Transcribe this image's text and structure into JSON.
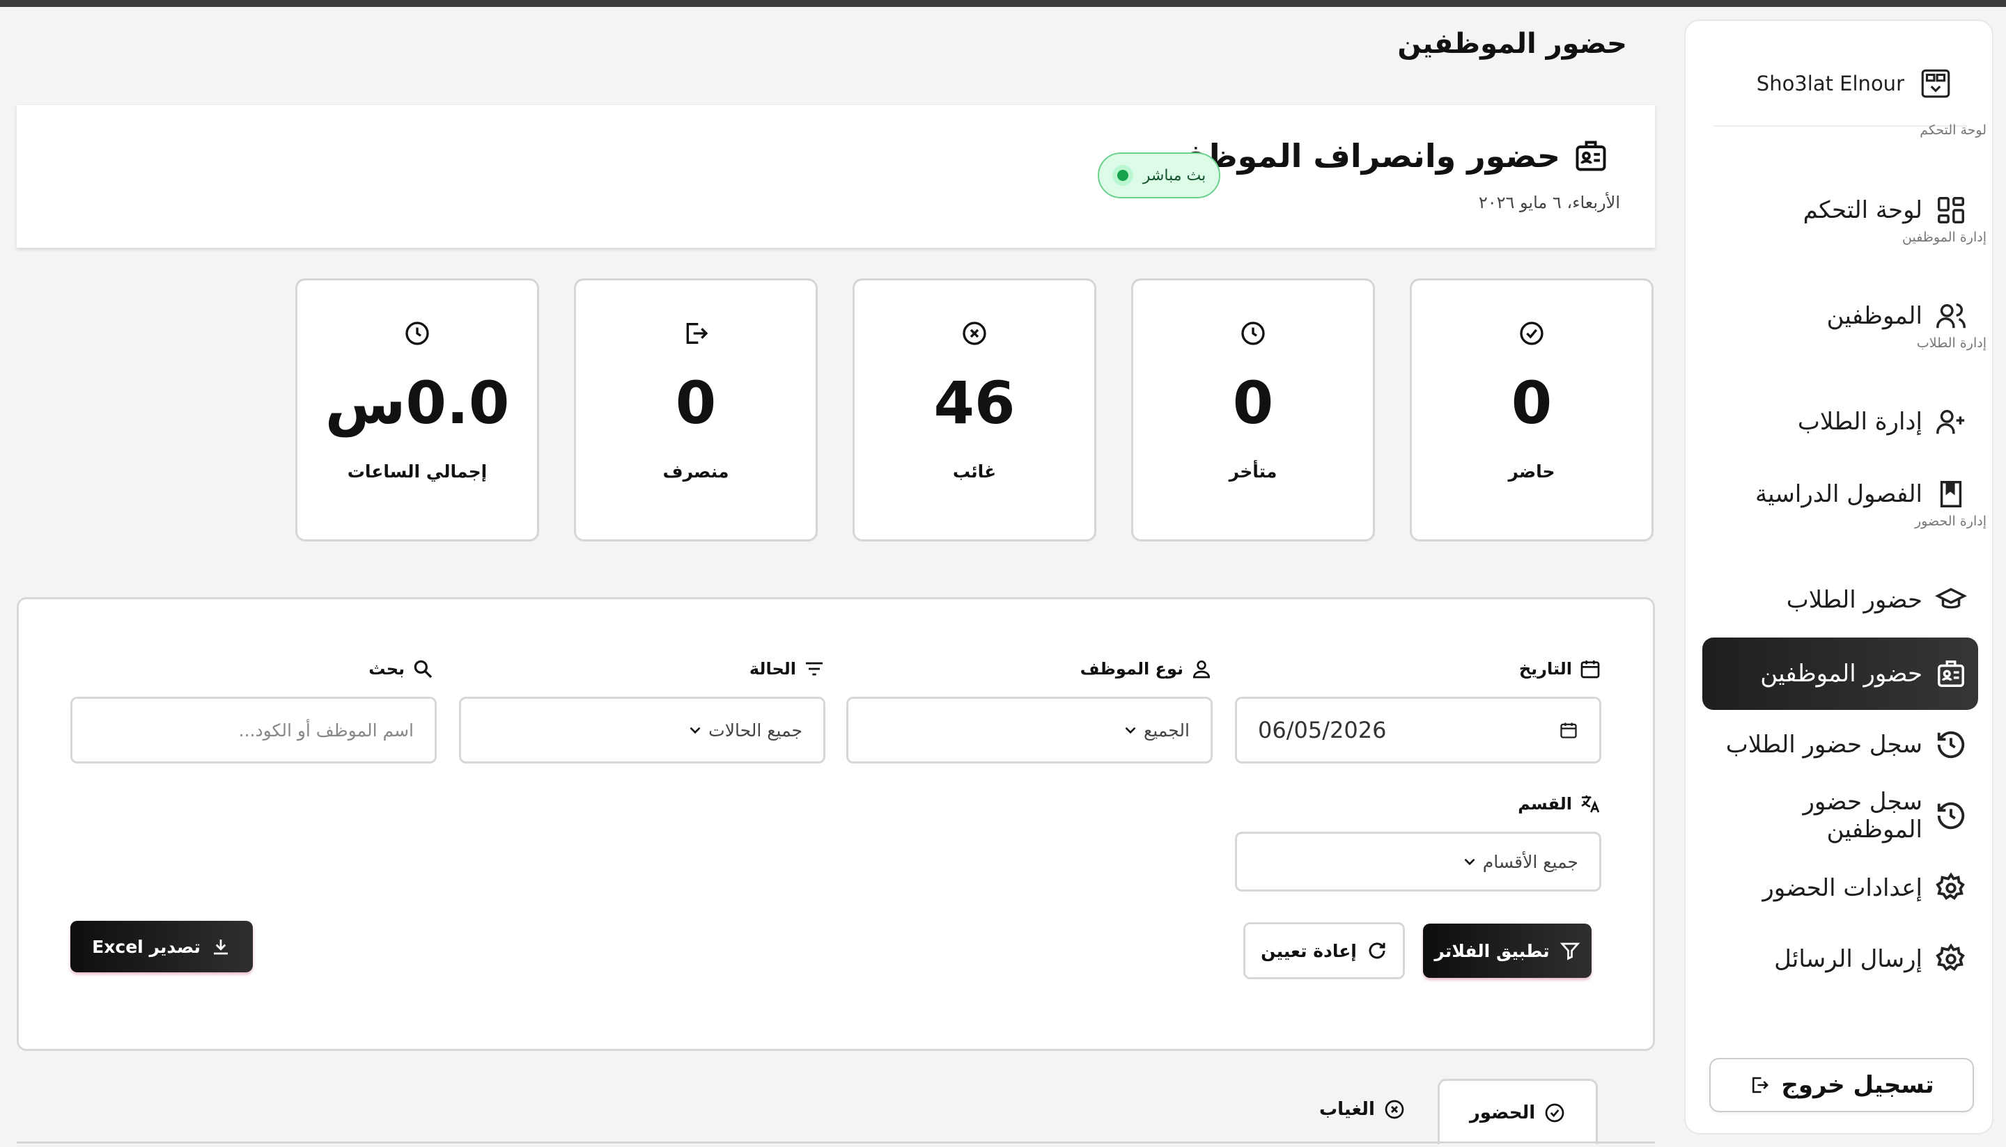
{
  "page": {
    "title": "حضور الموظفين"
  },
  "sidebar": {
    "brand": "Sho3lat Elnour",
    "sections": {
      "dashboard": "لوحة التحكم",
      "employees": "إدارة الموظفين",
      "students": "إدارة الطلاب",
      "attendance": "إدارة الحضور"
    },
    "items": [
      {
        "label": "لوحة التحكم",
        "icon": "dashboard-grid-icon"
      },
      {
        "label": "الموظفين",
        "icon": "users-icon"
      },
      {
        "label": "إدارة الطلاب",
        "icon": "user-plus-icon"
      },
      {
        "label": "الفصول الدراسية",
        "icon": "book-icon"
      },
      {
        "label": "حضور الطلاب",
        "icon": "graduation-cap-icon"
      },
      {
        "label": "حضور الموظفين",
        "icon": "id-badge-icon",
        "active": true
      },
      {
        "label": "سجل حضور الطلاب",
        "icon": "history-icon"
      },
      {
        "label": "سجل حضور الموظفين",
        "icon": "history-icon"
      },
      {
        "label": "إعدادات الحضور",
        "icon": "gear-icon"
      },
      {
        "label": "إرسال الرسائل",
        "icon": "gear-icon"
      }
    ],
    "logout": "تسجيل خروج"
  },
  "header": {
    "title": "حضور وانصراف الموظفين",
    "date": "الأربعاء، ٦ مايو ٢٠٢٦",
    "live": "بث مباشر"
  },
  "stats": [
    {
      "label": "حاضر",
      "value": "0",
      "icon": "check-circle-icon"
    },
    {
      "label": "متأخر",
      "value": "0",
      "icon": "clock-icon"
    },
    {
      "label": "غائب",
      "value": "46",
      "icon": "x-circle-icon"
    },
    {
      "label": "منصرف",
      "value": "0",
      "icon": "logout-icon"
    },
    {
      "label": "إجمالي الساعات",
      "value": "0.0س",
      "icon": "clock-icon"
    }
  ],
  "filters": {
    "date_label": "التاريخ",
    "date_value": "06/05/2026",
    "type_label": "نوع الموظف",
    "type_value": "الجميع",
    "status_label": "الحالة",
    "status_value": "جميع الحالات",
    "search_label": "بحث",
    "search_placeholder": "اسم الموظف أو الكود...",
    "dept_label": "القسم",
    "dept_value": "جميع الأقسام",
    "apply": "تطبيق الفلاتر",
    "reset": "إعادة تعيين",
    "export": "تصدير Excel"
  },
  "tabs": {
    "attendance": "الحضور",
    "absence": "الغياب"
  },
  "colors": {
    "accent": "#1e1e1e",
    "live_green": "#16a34a",
    "live_bg": "#dcfce7"
  }
}
